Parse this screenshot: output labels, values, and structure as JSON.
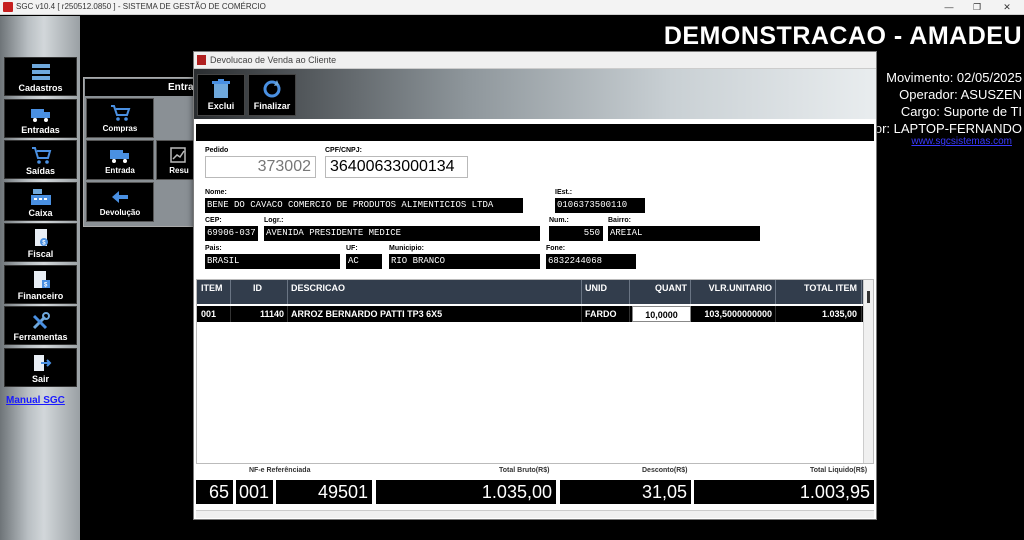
{
  "window": {
    "title": "SGC v10.4 [ r250512.0850 ] - SISTEMA DE GESTÃO DE COMÉRCIO",
    "controls": [
      "—",
      "❐",
      "✕"
    ]
  },
  "sidebar": {
    "items": [
      {
        "label": "Cadastros",
        "icon": "cadastros-icon"
      },
      {
        "label": "Entradas",
        "icon": "truck-icon"
      },
      {
        "label": "Saídas",
        "icon": "cart-icon"
      },
      {
        "label": "Caixa",
        "icon": "cash-register-icon"
      },
      {
        "label": "Fiscal",
        "icon": "fiscal-document-icon"
      },
      {
        "label": "Financeiro",
        "icon": "finance-document-icon"
      },
      {
        "label": "Ferramentas",
        "icon": "tools-icon"
      },
      {
        "label": "Sair",
        "icon": "exit-door-icon"
      }
    ],
    "manual_link": "Manual SGC"
  },
  "header": {
    "brand": "DEMONSTRACAO - AMADEU",
    "movimento": "Movimento: 02/05/2025",
    "operador": "Operador: ASUSZEN",
    "cargo": "Cargo: Suporte de TI",
    "computador": "or: LAPTOP-FERNANDO",
    "site": "www.sgcsistemas.com"
  },
  "submenu": {
    "title": "Entra",
    "buttons": [
      {
        "label": "Compras",
        "icon": "shopping-cart-icon"
      },
      {
        "label": "Entrada",
        "icon": "truck-icon"
      },
      {
        "label": "Resu",
        "icon": "chart-icon"
      },
      {
        "label": "Devolução",
        "icon": "return-arrow-icon"
      }
    ]
  },
  "dialog": {
    "title": "Devolucao de Venda ao Cliente",
    "toolbar": {
      "exclui_label": "Exclui",
      "finalizar_label": "Finalizar"
    },
    "form": {
      "pedido_label": "Pedido",
      "pedido": "373002",
      "cpf_label": "CPF/CNPJ:",
      "cpf": "36400633000134",
      "nome_label": "Nome:",
      "nome": "BENE DO CAVACO COMERCIO DE PRODUTOS ALIMENTICIOS LTDA",
      "iest_label": "IEst.:",
      "iest": "0106373500110",
      "cep_label": "CEP:",
      "cep": "69906-037",
      "logr_label": "Logr.:",
      "logr": "AVENIDA PRESIDENTE MEDICE",
      "num_label": "Num.:",
      "num": "550",
      "bairro_label": "Bairro:",
      "bairro": "AREIAL",
      "pais_label": "Pais:",
      "pais": "BRASIL",
      "uf_label": "UF:",
      "uf": "AC",
      "municipio_label": "Municipio:",
      "municipio": "RIO BRANCO",
      "fone_label": "Fone:",
      "fone": "6832244068"
    },
    "grid": {
      "headers": [
        "ITEM",
        "ID",
        "DESCRICAO",
        "UNID",
        "QUANT",
        "VLR.UNITARIO",
        "TOTAL ITEM"
      ],
      "rows": [
        [
          "001",
          "11140",
          "ARROZ BERNARDO PATTI TP3 6X5",
          "FARDO",
          "10,0000",
          "103,5000000000",
          "1.035,00"
        ]
      ]
    },
    "totals": {
      "nfe_label": "NF-e Referênciada",
      "nfe_a": "65",
      "nfe_b": "001",
      "nfe_c": "49501",
      "bruto_label": "Total Bruto(R$)",
      "bruto": "1.035,00",
      "desconto_label": "Desconto(R$)",
      "desconto": "31,05",
      "liquido_label": "Total Liquido(R$)",
      "liquido": "1.003,95"
    }
  }
}
